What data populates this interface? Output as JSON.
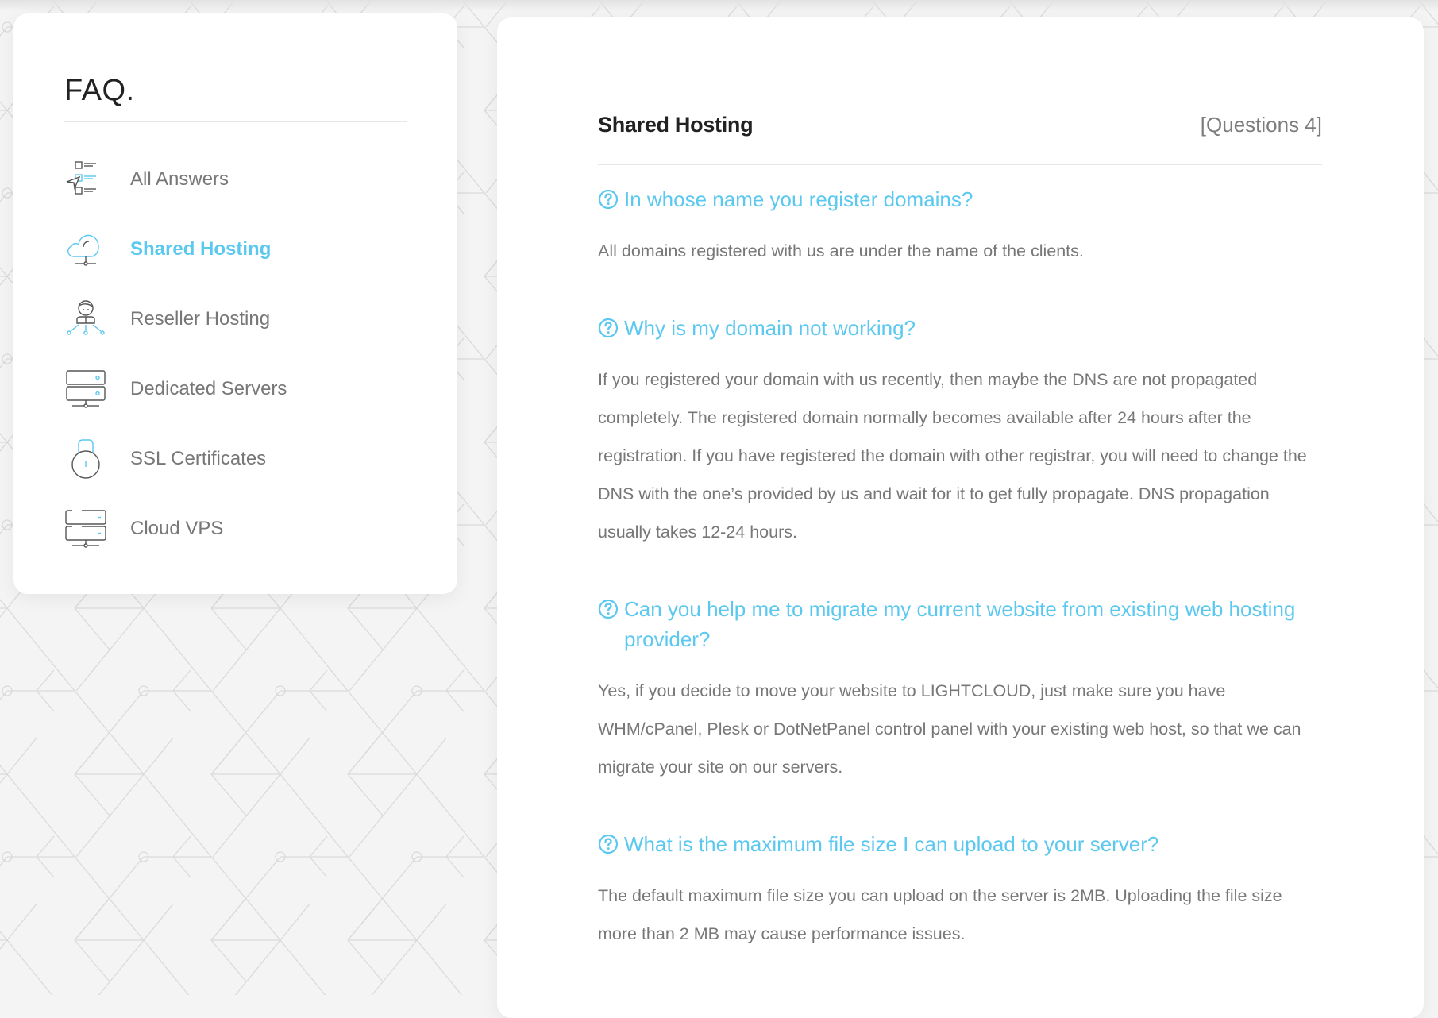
{
  "colors": {
    "accent": "#5bc8f0",
    "heading": "#222222",
    "body_text": "#777777",
    "background": "#f4f4f4",
    "card": "#ffffff"
  },
  "sidebar": {
    "title": "FAQ.",
    "active_index": 1,
    "items": [
      {
        "label": "All Answers",
        "icon": "checklist-cursor-icon"
      },
      {
        "label": "Shared Hosting",
        "icon": "cloud-network-icon"
      },
      {
        "label": "Reseller Hosting",
        "icon": "user-network-icon"
      },
      {
        "label": "Dedicated Servers",
        "icon": "server-stack-icon"
      },
      {
        "label": "SSL Certificates",
        "icon": "padlock-icon"
      },
      {
        "label": "Cloud VPS",
        "icon": "cloud-server-icon"
      }
    ]
  },
  "main": {
    "title": "Shared Hosting",
    "question_count": "[Questions 4]",
    "question_icon": "question-circle-icon",
    "faqs": [
      {
        "question": "In whose name you register domains?",
        "answer": "All domains registered with us are under the name of the clients."
      },
      {
        "question": "Why is my domain not working?",
        "answer": "If you registered your domain with us recently, then maybe the DNS are not propagated completely. The registered domain normally becomes available after 24 hours after the registration. If you have registered the domain with other registrar, you will need to change the DNS with the one’s provided by us and wait for it to get fully propagate. DNS propagation usually takes 12-24 hours."
      },
      {
        "question": "Can you help me to migrate my current website from existing web hosting provider?",
        "answer": "Yes, if you decide to move your website to LIGHTCLOUD, just make sure you have WHM/cPanel, Plesk or DotNetPanel control panel with your existing web host, so that we can migrate your site on our servers."
      },
      {
        "question": "What is the maximum file size I can upload to your server?",
        "answer": "The default maximum file size you can upload on the server is 2MB. Uploading the file size more than 2 MB may cause performance issues."
      }
    ]
  }
}
